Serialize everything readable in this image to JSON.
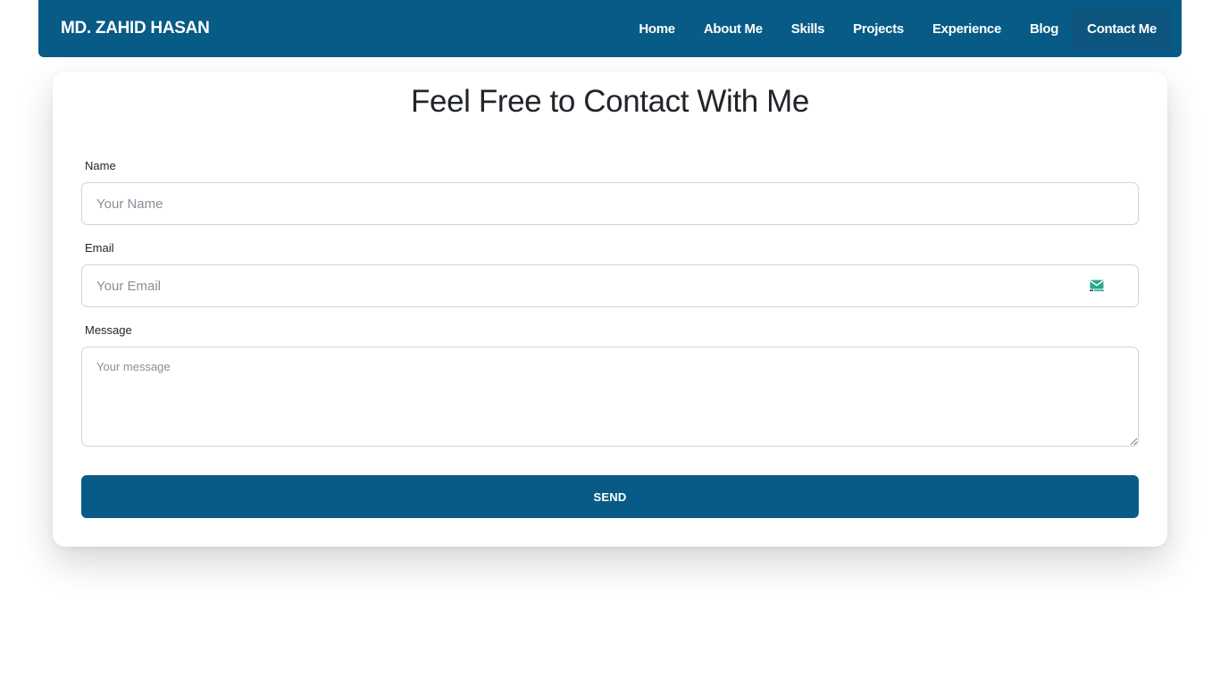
{
  "brand": "MD. ZAHID HASAN",
  "nav": {
    "items": [
      {
        "label": "Home"
      },
      {
        "label": "About Me"
      },
      {
        "label": "Skills"
      },
      {
        "label": "Projects"
      },
      {
        "label": "Experience"
      },
      {
        "label": "Blog"
      },
      {
        "label": "Contact Me"
      }
    ],
    "active": "Contact Me"
  },
  "contact": {
    "title": "Feel Free to Contact With Me",
    "name": {
      "label": "Name",
      "placeholder": "Your Name",
      "value": ""
    },
    "email": {
      "label": "Email",
      "placeholder": "Your Email",
      "value": "",
      "icon": "mail-icon"
    },
    "message": {
      "label": "Message",
      "placeholder": "Your message",
      "value": ""
    },
    "send_label": "SEND"
  },
  "colors": {
    "primary": "#075b86",
    "nav_active": "#0d557e",
    "icon_green": "#2aa88a"
  }
}
